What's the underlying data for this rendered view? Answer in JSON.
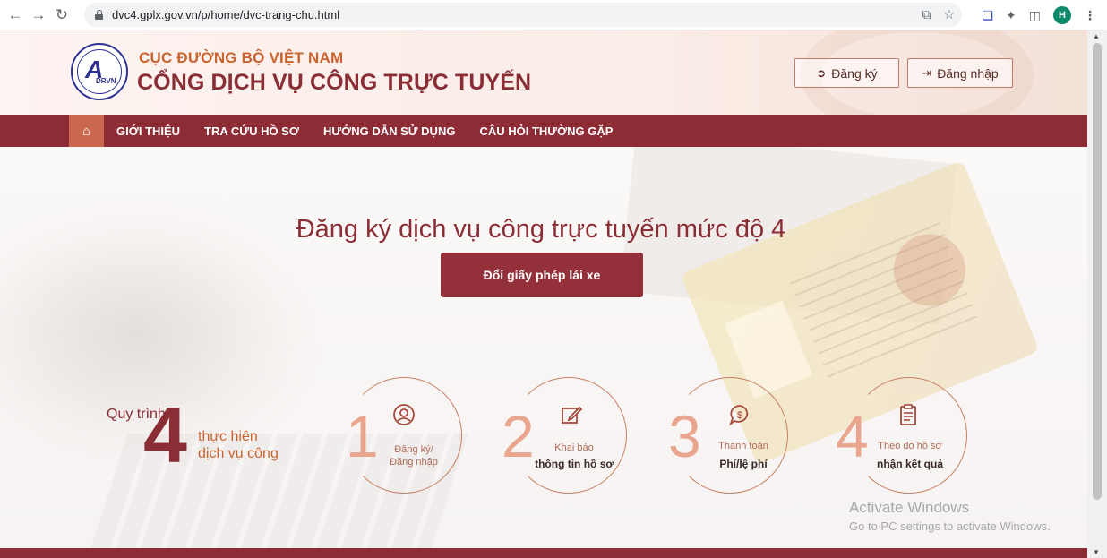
{
  "browser": {
    "url": "dvc4.gplx.gov.vn/p/home/dvc-trang-chu.html",
    "avatar_letter": "H"
  },
  "header": {
    "org_name": "CỤC ĐƯỜNG BỘ VIỆT NAM",
    "portal_name": "CỔNG DỊCH VỤ CÔNG TRỰC TUYẾN",
    "logo_text": "DRVN",
    "register_label": "Đăng ký",
    "login_label": "Đăng nhập"
  },
  "nav": {
    "items": [
      "GIỚI THIỆU",
      "TRA CỨU HỒ SƠ",
      "HƯỚNG DẪN SỬ DỤNG",
      "CÂU HỎI THƯỜNG GẶP"
    ]
  },
  "hero": {
    "title": "Đăng ký dịch vụ công trực tuyến mức độ 4",
    "cta_label": "Đổi giấy phép lái xe"
  },
  "process": {
    "label": "Quy trình",
    "count": "4",
    "text_line1": "thực hiện",
    "text_line2": "dịch vụ công",
    "steps": [
      {
        "num": "1",
        "line1": "Đăng ký/",
        "line2": "Đăng nhập"
      },
      {
        "num": "2",
        "line1": "Khai báo",
        "line2": "thông tin hồ sơ"
      },
      {
        "num": "3",
        "line1": "Thanh toán",
        "line2": "Phí/lệ phí"
      },
      {
        "num": "4",
        "line1": "Theo dõ hồ sơ",
        "line2": "nhận kết quả"
      }
    ]
  },
  "watermark": {
    "line1": "Activate Windows",
    "line2": "Go to PC settings to activate Windows."
  },
  "colors": {
    "brand_dark": "#8e2c35",
    "brand_orange": "#c9642f",
    "home_tab": "#c9674f"
  }
}
